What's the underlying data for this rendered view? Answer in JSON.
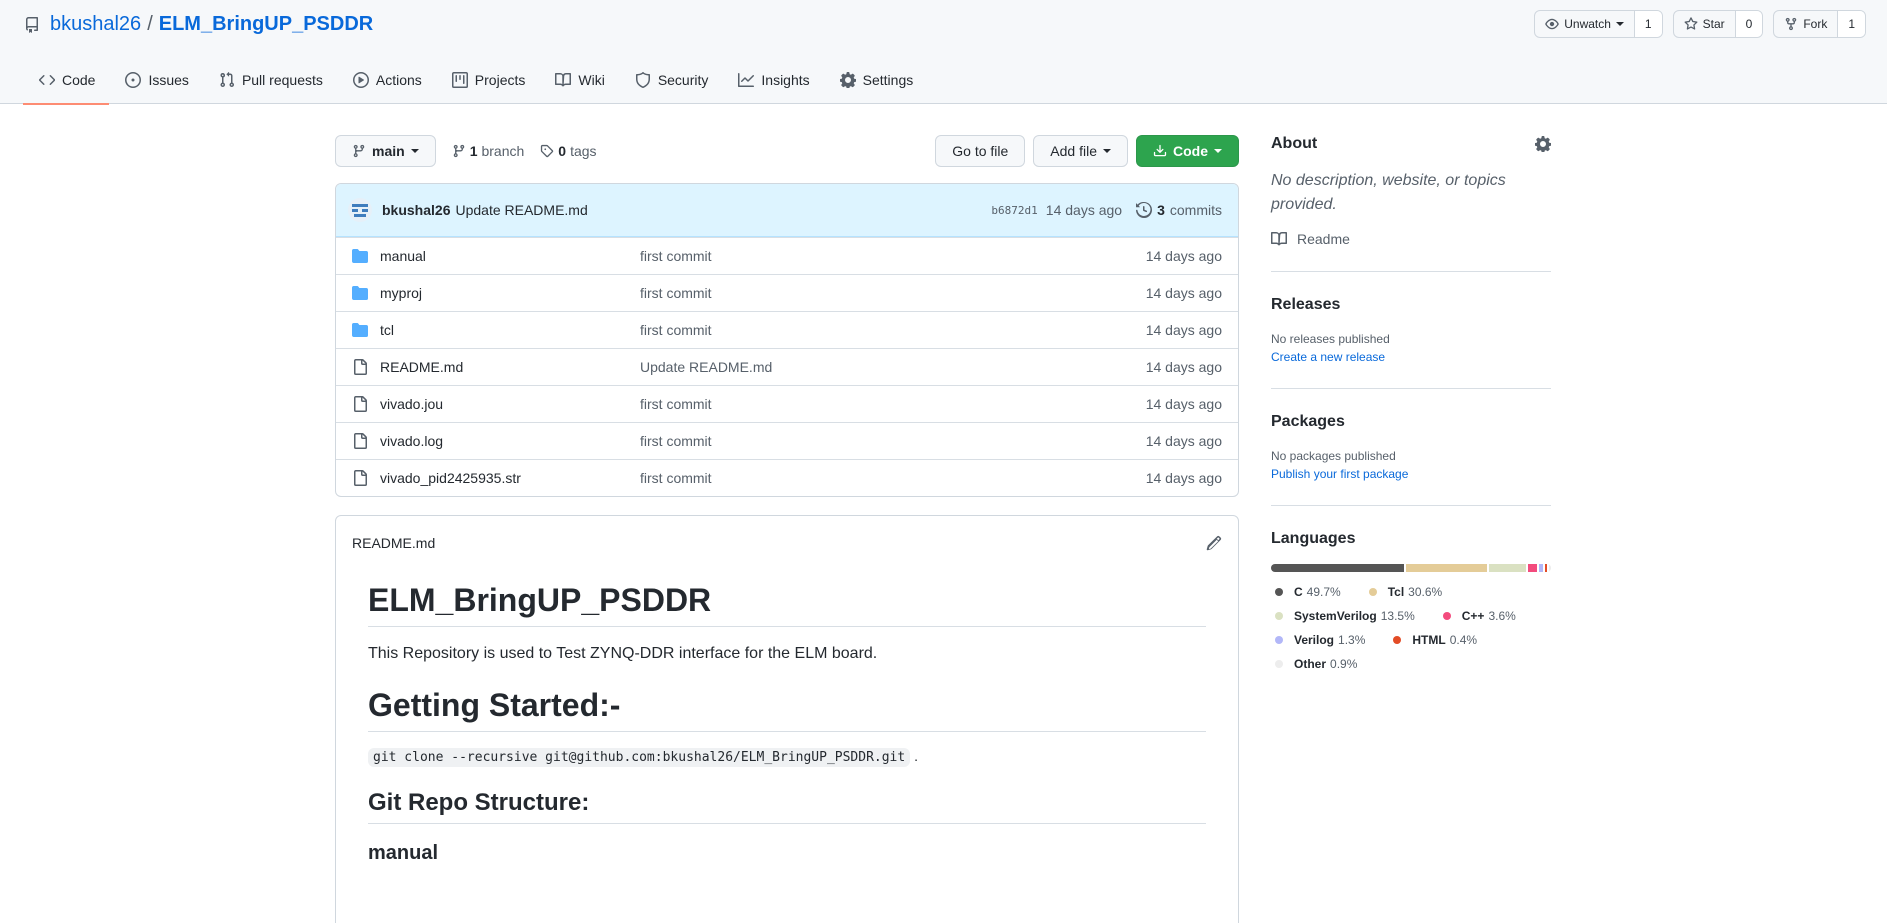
{
  "repo": {
    "owner": "bkushal26",
    "separator": "/",
    "name": "ELM_BringUP_PSDDR"
  },
  "header_buttons": {
    "watch_label": "Unwatch",
    "watch_count": "1",
    "star_label": "Star",
    "star_count": "0",
    "fork_label": "Fork",
    "fork_count": "1"
  },
  "tabs": [
    {
      "label": "Code",
      "icon": "code-icon",
      "active": true
    },
    {
      "label": "Issues",
      "icon": "issue-icon"
    },
    {
      "label": "Pull requests",
      "icon": "pull-request-icon"
    },
    {
      "label": "Actions",
      "icon": "play-icon"
    },
    {
      "label": "Projects",
      "icon": "project-icon"
    },
    {
      "label": "Wiki",
      "icon": "book-icon"
    },
    {
      "label": "Security",
      "icon": "shield-icon"
    },
    {
      "label": "Insights",
      "icon": "graph-icon"
    },
    {
      "label": "Settings",
      "icon": "gear-icon"
    }
  ],
  "toolbar": {
    "branch": "main",
    "branch_count": "1",
    "branch_label": "branch",
    "tag_count": "0",
    "tag_label": "tags",
    "go_to_file": "Go to file",
    "add_file": "Add file",
    "code_button": "Code"
  },
  "latest_commit": {
    "author": "bkushal26",
    "message": "Update README.md",
    "sha": "b6872d1",
    "age": "14 days ago",
    "commit_count": "3",
    "commit_label": "commits"
  },
  "files": [
    {
      "name": "manual",
      "type": "dir",
      "message": "first commit",
      "age": "14 days ago"
    },
    {
      "name": "myproj",
      "type": "dir",
      "message": "first commit",
      "age": "14 days ago"
    },
    {
      "name": "tcl",
      "type": "dir",
      "message": "first commit",
      "age": "14 days ago"
    },
    {
      "name": "README.md",
      "type": "file",
      "message": "Update README.md",
      "age": "14 days ago"
    },
    {
      "name": "vivado.jou",
      "type": "file",
      "message": "first commit",
      "age": "14 days ago"
    },
    {
      "name": "vivado.log",
      "type": "file",
      "message": "first commit",
      "age": "14 days ago"
    },
    {
      "name": "vivado_pid2425935.str",
      "type": "file",
      "message": "first commit",
      "age": "14 days ago"
    }
  ],
  "readme": {
    "filename": "README.md",
    "title": "ELM_BringUP_PSDDR",
    "intro": "This Repository is used to Test ZYNQ-DDR interface for the ELM board.",
    "getting_started": "Getting Started:-",
    "clone_cmd": "git clone --recursive git@github.com:bkushal26/ELM_BringUP_PSDDR.git",
    "clone_suffix": ".",
    "structure": "Git Repo Structure:",
    "manual": "manual"
  },
  "sidebar": {
    "about_title": "About",
    "about_desc": "No description, website, or topics provided.",
    "readme_link": "Readme",
    "releases_title": "Releases",
    "releases_none": "No releases published",
    "releases_link": "Create a new release",
    "packages_title": "Packages",
    "packages_none": "No packages published",
    "packages_link": "Publish your first package",
    "languages_title": "Languages"
  },
  "languages": [
    {
      "name": "C",
      "percent": "49.7%",
      "value": 49.7,
      "color": "#555555"
    },
    {
      "name": "Tcl",
      "percent": "30.6%",
      "value": 30.6,
      "color": "#e4cc98"
    },
    {
      "name": "SystemVerilog",
      "percent": "13.5%",
      "value": 13.5,
      "color": "#dae1c2"
    },
    {
      "name": "C++",
      "percent": "3.6%",
      "value": 3.6,
      "color": "#f34b7d"
    },
    {
      "name": "Verilog",
      "percent": "1.3%",
      "value": 1.3,
      "color": "#b2b7f8"
    },
    {
      "name": "HTML",
      "percent": "0.4%",
      "value": 0.4,
      "color": "#e34c26"
    },
    {
      "name": "Other",
      "percent": "0.9%",
      "value": 0.9,
      "color": "#ededed"
    }
  ]
}
